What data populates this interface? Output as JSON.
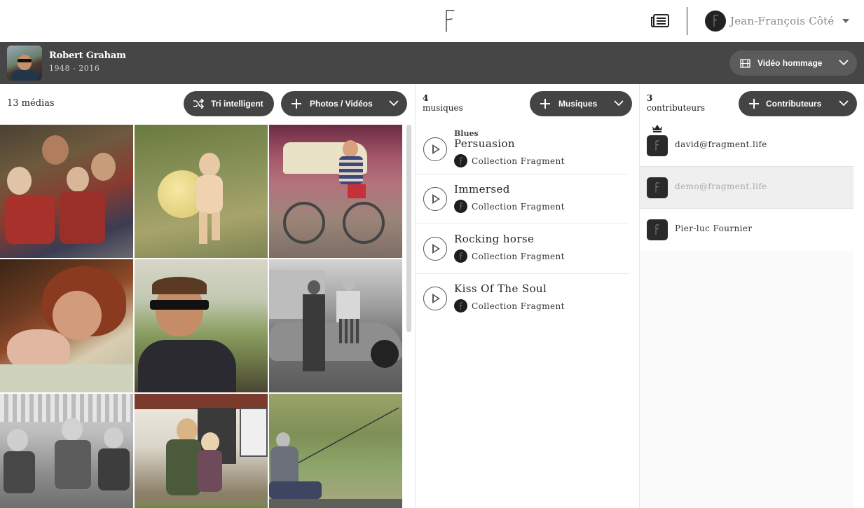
{
  "header": {
    "user_name": "Jean-François Côté"
  },
  "profile": {
    "name": "Robert Graham",
    "dates": "1948 - 2016",
    "tribute_button": "Vidéo hommage"
  },
  "media": {
    "count_label": "13 médias",
    "smart_sort_button": "Tri intelligent",
    "add_button": "Photos / Vidéos"
  },
  "music": {
    "count": "4",
    "count_label": "musiques",
    "add_button": "Musiques",
    "tracks": [
      {
        "genre": "Blues",
        "title": "Persuasion",
        "collection": "Collection Fragment"
      },
      {
        "genre": "",
        "title": "Immersed",
        "collection": "Collection Fragment"
      },
      {
        "genre": "",
        "title": "Rocking horse",
        "collection": "Collection Fragment"
      },
      {
        "genre": "",
        "title": "Kiss Of The Soul",
        "collection": "Collection Fragment"
      }
    ]
  },
  "contributors": {
    "count": "3",
    "count_label": "contributeurs",
    "add_button": "Contributeurs",
    "items": [
      {
        "email": "david@fragment.life",
        "owner": true
      },
      {
        "email": "demo@fragment.life",
        "owner": false
      },
      {
        "email": "Pier-luc Fournier",
        "owner": false
      }
    ]
  },
  "icons": {
    "logo": "fragment-logo",
    "news": "newspaper-icon",
    "shuffle": "shuffle-icon",
    "plus": "plus-icon",
    "chevron": "chevron-down-icon",
    "film": "film-icon",
    "play": "play-icon",
    "crown": "crown-icon"
  },
  "colors": {
    "band": "#464646",
    "pill": "#444444",
    "pill_light": "#5b5b5b"
  }
}
